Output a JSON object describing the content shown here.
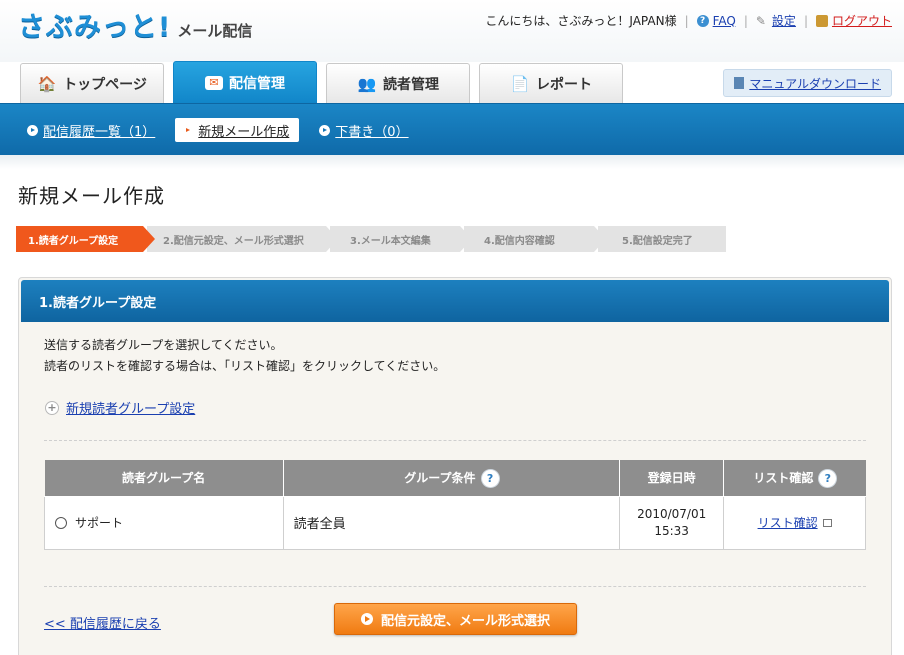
{
  "header": {
    "logo_main": "さぶみっと!",
    "logo_sub": "メール配信",
    "greeting": "こんにちは、さぶみっと！JAPAN様",
    "faq": "FAQ",
    "settings": "設定",
    "logout": "ログアウト"
  },
  "tabs": [
    {
      "label": "トップページ",
      "icon": "home-icon"
    },
    {
      "label": "配信管理",
      "icon": "mail-icon"
    },
    {
      "label": "読者管理",
      "icon": "readers-icon"
    },
    {
      "label": "レポート",
      "icon": "report-icon"
    }
  ],
  "manual_download": "マニュアルダウンロード",
  "subnav": [
    {
      "label": "配信履歴一覧（1）"
    },
    {
      "label": "新規メール作成"
    },
    {
      "label": "下書き（0）"
    }
  ],
  "page_title": "新規メール作成",
  "steps": [
    "1.読者グループ設定",
    "2.配信元設定、メール形式選択",
    "3.メール本文編集",
    "4.配信内容確認",
    "5.配信設定完了"
  ],
  "panel": {
    "title": "1.読者グループ設定",
    "desc_line1": "送信する読者グループを選択してください。",
    "desc_line2": "読者のリストを確認する場合は、「リスト確認」をクリックしてください。",
    "new_group_link": "新規読者グループ設定"
  },
  "table": {
    "headers": [
      "読者グループ名",
      "グループ条件",
      "登録日時",
      "リスト確認"
    ],
    "rows": [
      {
        "name": "サポート",
        "condition": "読者全員",
        "date": "2010/07/01",
        "time": "15:33",
        "list": "リスト確認"
      }
    ]
  },
  "back_link": "<< 配信履歴に戻る",
  "next_button": "配信元設定、メール形式選択",
  "colors": {
    "brand": "#1f8fd6",
    "accent": "#f0581c",
    "nav": "#1b86c6"
  }
}
